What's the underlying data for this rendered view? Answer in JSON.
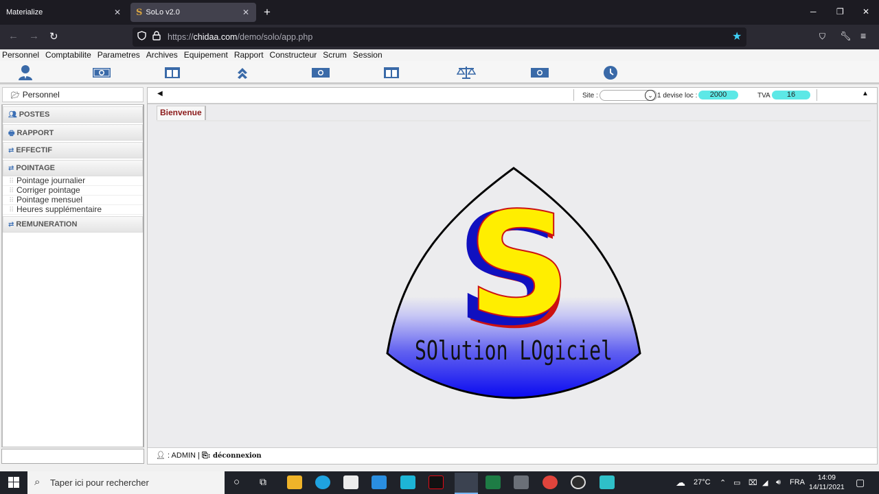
{
  "browser": {
    "tabs": [
      {
        "label": "Materialize"
      },
      {
        "label": "SoLo v2.0",
        "favicon": "S"
      }
    ],
    "url": {
      "scheme": "https://",
      "host": "chidaa.com",
      "path": "/demo/solo/app.php"
    }
  },
  "menubar": {
    "items": [
      "Personnel",
      "Comptabilite",
      "Parametres",
      "Archives",
      "Equipement",
      "Rapport",
      "Constructeur",
      "Scrum",
      "Session"
    ]
  },
  "toolbar": {
    "icons": [
      "user-icon",
      "money-icon",
      "columns-icon",
      "chevrons-up-icon",
      "money-icon",
      "columns-icon",
      "balance-icon",
      "money-icon",
      "clock-icon"
    ]
  },
  "sidebar": {
    "header": "Personnel",
    "sections": [
      {
        "label": "POSTES",
        "icon": "users-icon"
      },
      {
        "label": "RAPPORT",
        "icon": "report-icon"
      },
      {
        "label": "EFFECTIF",
        "icon": "exchange-icon"
      },
      {
        "label": "POINTAGE",
        "icon": "exchange-icon",
        "items": [
          "Pointage journalier",
          "Corriger pointage",
          "Pointage mensuel",
          "Heures supplémentaire"
        ]
      },
      {
        "label": "REMUNERATION",
        "icon": "exchange-icon"
      }
    ]
  },
  "topstrip": {
    "site_label": "Site :",
    "devise_label": "1 devise loc :",
    "devise_value": "2000",
    "tva_label": "TVA",
    "tva_value": "16"
  },
  "content": {
    "welcome_tab": "Bienvenue",
    "logo_letter": "S",
    "logo_text": "SOlution LOgiciel"
  },
  "statusbar": {
    "user_sep": ":",
    "user": "ADMIN",
    "divider": "|",
    "logout": ": déconnexion"
  },
  "taskbar": {
    "search_placeholder": "Taper ici pour rechercher",
    "temperature": "27°C",
    "language": "FRA",
    "time": "14:09",
    "date": "14/11/2021"
  },
  "colors": {
    "accent_cyan": "#5de8e6",
    "logo_blue": "#1010e0",
    "logo_yellow": "#ffee00",
    "logo_red": "#cc1111",
    "welcome_red": "#8b1a1a"
  }
}
